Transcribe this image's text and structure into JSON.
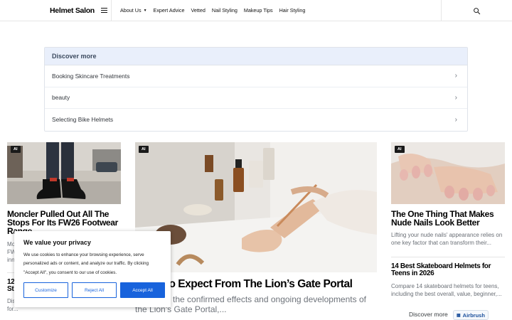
{
  "header": {
    "brand": "Helmet Salon",
    "nav": [
      {
        "label": "About Us",
        "has_dropdown": true
      },
      {
        "label": "Expert Advice"
      },
      {
        "label": "Vetted"
      },
      {
        "label": "Nail Styling"
      },
      {
        "label": "Makeup Tips"
      },
      {
        "label": "Hair Styling"
      }
    ],
    "search_icon": "search-icon"
  },
  "discover": {
    "heading": "Discover more",
    "items": [
      {
        "label": "Booking Skincare Treatments"
      },
      {
        "label": "beauty"
      },
      {
        "label": "Selecting Bike Helmets"
      }
    ]
  },
  "cards": {
    "left": {
      "badge": "AI",
      "title": "Moncler Pulled Out All The Stops For Its FW26 Footwear Range",
      "excerpt_partial": [
        "Mo",
        "FW",
        "inn"
      ],
      "second_title_partial": [
        "12",
        "St"
      ],
      "second_excerpt": "Dis students in 2026. Find the best options for..."
    },
    "center": {
      "badge": "AI",
      "title": "What To Expect From The Lion’s Gate Portal",
      "excerpt": "the confirmed effects and ongoing developments of the Lion’s Gate Portal,..."
    },
    "right": {
      "badge": "AI",
      "title": "The One Thing That Makes Nude Nails Look Better",
      "excerpt": "Lifting your nude nails' appearance relies on one key factor that can transform their...",
      "second_title": "14 Best Skateboard Helmets for Teens in 2026",
      "second_excerpt": "Compare 14 skateboard helmets for teens, including the best overall, value, beginner,..."
    }
  },
  "cookie": {
    "title": "We value your privacy",
    "text": "We use cookies to enhance your browsing experience, serve personalized ads or content, and analyze our traffic. By clicking \"Accept All\", you consent to our use of cookies.",
    "customize": "Customize",
    "reject": "Reject All",
    "accept": "Accept All",
    "accent": "#1863dc"
  },
  "footer_bar": {
    "discover_more": "Discover more",
    "airbrush": "Airbrush"
  }
}
